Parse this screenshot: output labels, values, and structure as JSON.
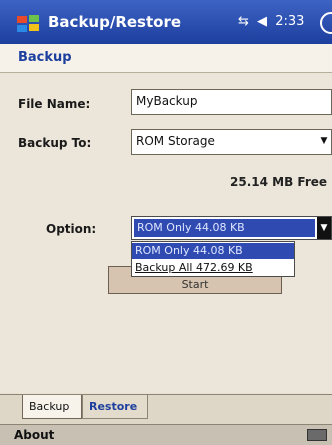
{
  "titlebar": {
    "title": "Backup/Restore",
    "status_time": "2:33",
    "signal_icon": "connectivity-icon",
    "volume_icon": "speaker-icon"
  },
  "header": {
    "title": "Backup"
  },
  "form": {
    "file_name_label": "File Name:",
    "file_name_value": "MyBackup",
    "backup_to_label": "Backup To:",
    "backup_to_value": "ROM Storage",
    "free_space": "25.14 MB Free",
    "option_label": "Option:",
    "option_selected": "ROM Only  44.08 KB",
    "option_items": [
      "ROM Only  44.08 KB",
      "Backup All  472.69 KB"
    ],
    "start_button": "Start"
  },
  "tabs": [
    "Backup",
    "Restore"
  ],
  "menubar": {
    "about": "About"
  },
  "colors": {
    "titlebar": "#1d3f9e",
    "selection": "#2f4bb2",
    "background": "#ece6da"
  }
}
